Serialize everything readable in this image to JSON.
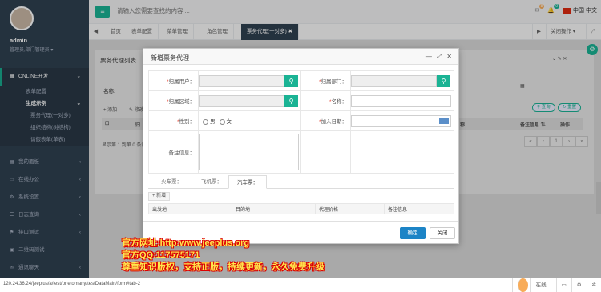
{
  "sidebar": {
    "user": {
      "name": "admin",
      "role": "管理员,部门管理员 ▾"
    },
    "items": [
      {
        "label": "ONLINE开发",
        "icon": "grid-icon",
        "active": true
      },
      {
        "label": "表单配置"
      },
      {
        "label": "生成示例"
      },
      {
        "label": "票务代理(一对多)"
      },
      {
        "label": "组织结构(树结构)"
      },
      {
        "label": "请假表单(单表)"
      },
      {
        "label": "我的面板",
        "icon": "grid-icon"
      },
      {
        "label": "在线办公",
        "icon": "monitor-icon"
      },
      {
        "label": "系统设置",
        "icon": "gear-icon"
      },
      {
        "label": "日志查询",
        "icon": "list-icon"
      },
      {
        "label": "接口测试",
        "icon": "plug-icon"
      },
      {
        "label": "二维码测试",
        "icon": "qr-icon"
      },
      {
        "label": "通讯聊天",
        "icon": "chat-icon"
      }
    ]
  },
  "topbar": {
    "search_placeholder": "请输入您需要查找的内容 ...",
    "mail_count": "8",
    "bell_count": "0",
    "language": "中国 中文"
  },
  "tabs": {
    "items": [
      "首页",
      "表单配置",
      "菜单管理",
      "角色管理",
      "票务代理(一对多)"
    ],
    "close_ops": "关闭操作 ▾"
  },
  "background": {
    "panel_title": "票务代理列表",
    "name_label": "名称:",
    "add_btn": "添加",
    "edit_btn": "修改",
    "search_btn": "查询",
    "reset_btn": "重置",
    "col_note": "备注信息",
    "col_op": "操作",
    "col_partial": "归",
    "col_partial2": "称",
    "footer": "显示第 1 到第 0 条记录",
    "page": "1"
  },
  "modal": {
    "title": "新增票务代理",
    "fields": {
      "user": "归属用户：",
      "dept": "归属部门：",
      "area": "归属区域：",
      "name": "名称：",
      "gender": "性别：",
      "male": "男",
      "female": "女",
      "join_date": "加入日期：",
      "note": "备注信息："
    },
    "subtabs": [
      "火车票：",
      "飞机票：",
      "汽车票："
    ],
    "add_label": "新增",
    "sub_columns": [
      "出发地",
      "目的地",
      "代理价格",
      "备注信息"
    ],
    "ok_label": "确定",
    "close_label": "关闭"
  },
  "watermark": {
    "line1": "官方网址:http:www.jeeplus.org",
    "line2": "官方QQ:117575171",
    "line3": "尊重知识版权，支持正版，持续更新，永久免费升级"
  },
  "status": {
    "url": "120.24.36.24/jeeplus/a/test/onetomany/testDataMain/form#tab-2",
    "online": "在线"
  }
}
